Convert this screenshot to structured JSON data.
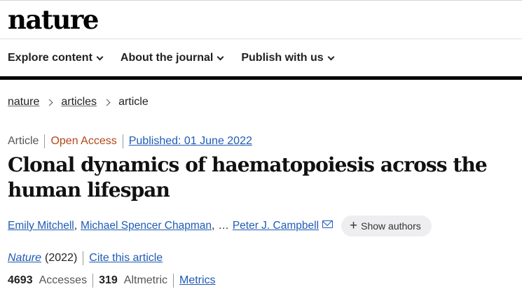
{
  "site": {
    "logo": "nature"
  },
  "nav": {
    "items": [
      {
        "label": "Explore content"
      },
      {
        "label": "About the journal"
      },
      {
        "label": "Publish with us"
      }
    ]
  },
  "breadcrumb": {
    "home": "nature",
    "section": "articles",
    "current": "article"
  },
  "article": {
    "type": "Article",
    "access": "Open Access",
    "published": "Published: 01 June 2022",
    "title": "Clonal dynamics of haematopoiesis across the human lifespan",
    "authors": [
      "Emily Mitchell",
      "Michael Spencer Chapman",
      "Peter J. Campbell"
    ],
    "author_sep": ",",
    "ellipsis": "…",
    "show_authors": "Show authors",
    "journal": "Nature",
    "year": "(2022)",
    "cite": "Cite this article"
  },
  "metrics": {
    "accesses_value": "4693",
    "accesses_label": "Accesses",
    "altmetric_value": "319",
    "altmetric_label": "Altmetric",
    "link": "Metrics"
  },
  "colors": {
    "link": "#1f5bb5",
    "open_access": "#b3471a",
    "nav_bar": "#000000"
  }
}
